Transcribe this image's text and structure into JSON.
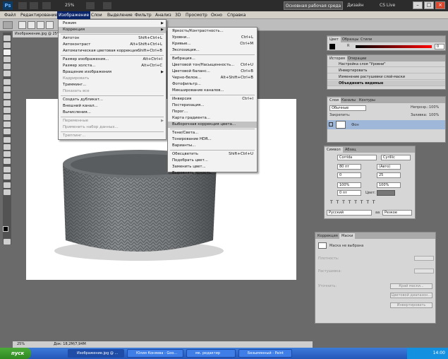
{
  "app": {
    "logo": "Ps",
    "zoom": "25%",
    "workspace": "Основная рабочая среда",
    "design": "Дизайн",
    "cslive": "CS Live"
  },
  "menubar": [
    "Файл",
    "Редактирование",
    "Изображение",
    "Слои",
    "Выделение",
    "Фильтр",
    "Анализ",
    "3D",
    "Просмотр",
    "Окно",
    "Справка"
  ],
  "document": {
    "tab": "Изображение.jpg @ 25% (RGB/8)",
    "zoom": "25%",
    "status": "Док: 18,2M/7,94M"
  },
  "image_menu": {
    "items": [
      {
        "label": "Режим",
        "sc": "",
        "sub": true
      },
      {
        "label": "Коррекция",
        "sc": "",
        "sub": true,
        "hl": true
      },
      {
        "label": "Автотон",
        "sc": "Shift+Ctrl+L"
      },
      {
        "label": "Автоконтраст",
        "sc": "Alt+Shift+Ctrl+L"
      },
      {
        "label": "Автоматическая цветовая коррекция",
        "sc": "Shift+Ctrl+B"
      },
      {
        "label": "Размер изображения...",
        "sc": "Alt+Ctrl+I"
      },
      {
        "label": "Размер холста...",
        "sc": "Alt+Ctrl+C"
      },
      {
        "label": "Вращение изображения",
        "sc": "",
        "sub": true
      },
      {
        "label": "Кадрировать",
        "sc": "",
        "dis": true
      },
      {
        "label": "Тримминг...",
        "sc": ""
      },
      {
        "label": "Показать все",
        "sc": "",
        "dis": true
      },
      {
        "label": "Создать дубликат...",
        "sc": ""
      },
      {
        "label": "Внешний канал...",
        "sc": ""
      },
      {
        "label": "Вычисления...",
        "sc": ""
      },
      {
        "label": "Переменные",
        "sc": "",
        "sub": true,
        "dis": true
      },
      {
        "label": "Применить набор данных...",
        "sc": "",
        "dis": true
      },
      {
        "label": "Треппинг...",
        "sc": "",
        "dis": true
      }
    ]
  },
  "adjust_menu": {
    "items": [
      {
        "label": "Яркость/Контрастность...",
        "sc": ""
      },
      {
        "label": "Уровни...",
        "sc": "Ctrl+L"
      },
      {
        "label": "Кривые...",
        "sc": "Ctrl+M"
      },
      {
        "label": "Экспозиция...",
        "sc": ""
      },
      {
        "label": "Вибрация...",
        "sc": ""
      },
      {
        "label": "Цветовой тон/Насыщенность...",
        "sc": "Ctrl+U"
      },
      {
        "label": "Цветовой баланс...",
        "sc": "Ctrl+B"
      },
      {
        "label": "Черно-белое...",
        "sc": "Alt+Shift+Ctrl+B"
      },
      {
        "label": "Фотофильтр...",
        "sc": ""
      },
      {
        "label": "Микширование каналов...",
        "sc": ""
      },
      {
        "label": "Инверсия",
        "sc": "Ctrl+I"
      },
      {
        "label": "Постеризация...",
        "sc": ""
      },
      {
        "label": "Порог...",
        "sc": ""
      },
      {
        "label": "Карта градиента...",
        "sc": ""
      },
      {
        "label": "Выборочная коррекция цвета...",
        "sc": "",
        "hl": true
      },
      {
        "label": "Тени/Света...",
        "sc": ""
      },
      {
        "label": "Тонирование HDR...",
        "sc": ""
      },
      {
        "label": "Варианты...",
        "sc": ""
      },
      {
        "label": "Обесцветить",
        "sc": "Shift+Ctrl+U"
      },
      {
        "label": "Подобрать цвет...",
        "sc": ""
      },
      {
        "label": "Заменить цвет...",
        "sc": ""
      },
      {
        "label": "Выровнять яркость",
        "sc": ""
      }
    ]
  },
  "color_panel": {
    "tabs": [
      "Цвет",
      "Образцы",
      "Стили"
    ],
    "channel": "R",
    "value": "0"
  },
  "history_panel": {
    "tabs": [
      "История",
      "Операции"
    ],
    "items": [
      "Настройка слоя \"Уровни\"",
      "Инвертировать",
      "Изменение растушевки слой-маски",
      "Объединить видимые"
    ]
  },
  "layers_panel": {
    "tabs": [
      "Слои",
      "Каналы",
      "Контуры"
    ],
    "blend": "Обычные",
    "opacity_label": "Непрозр.:",
    "opacity": "100%",
    "lock_label": "Закрепить:",
    "fill_label": "Заливка:",
    "fill": "100%",
    "layer_name": "Фон"
  },
  "char_panel": {
    "tabs": [
      "Символ",
      "Абзац"
    ],
    "font": "Corrida",
    "style": "Cyrillic",
    "size": "80 пт",
    "leading": "(Авто)",
    "kerning": "0",
    "tracking": "25",
    "vscale": "100%",
    "hscale": "100%",
    "baseline": "0 пт",
    "color_label": "Цвет:",
    "lang": "Русский",
    "aa_icon": "aa",
    "aa": "Резкое"
  },
  "masks_panel": {
    "tabs": [
      "Коррекция",
      "Маски"
    ],
    "none": "Маска не выбрана",
    "density": "Плотность:",
    "feather": "Растушевка:",
    "refine": "Уточнить:",
    "btn1": "Край маски...",
    "btn2": "Цветовой диапазон...",
    "btn3": "Инвертировать"
  },
  "taskbar": {
    "start": "пуск",
    "tasks": [
      "Изображение.jpg @ ...",
      "Юлия Коняева - Goo...",
      "мк. редактир",
      "Безымянный - Paint"
    ],
    "time": "14:00"
  }
}
